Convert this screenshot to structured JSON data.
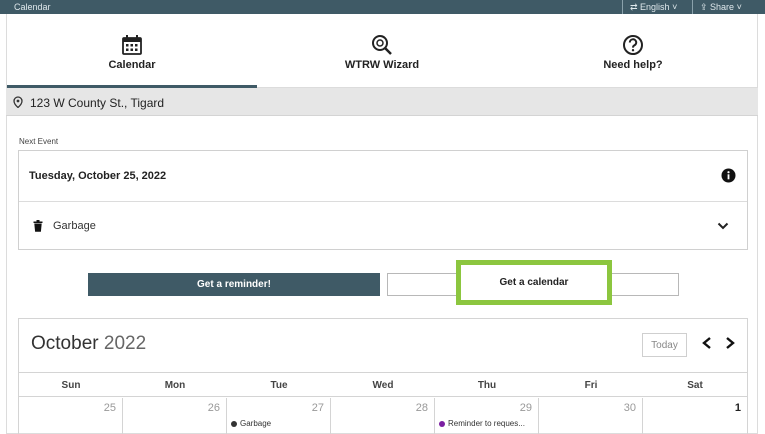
{
  "topbar": {
    "title": "Calendar",
    "language": "English",
    "share": "Share"
  },
  "nav": [
    {
      "label": "Calendar",
      "icon": "calendar-icon",
      "active": true
    },
    {
      "label": "WTRW Wizard",
      "icon": "wizard-search-icon",
      "active": false
    },
    {
      "label": "Need help?",
      "icon": "help-icon",
      "active": false
    }
  ],
  "address": {
    "text": "123 W County St., Tigard",
    "icon": "location-pin-icon"
  },
  "next_event": {
    "label": "Next Event",
    "date": "Tuesday, October 25, 2022",
    "type": "Garbage"
  },
  "buttons": {
    "reminder": "Get a reminder!",
    "calendar": "Get a calendar"
  },
  "calendar": {
    "month": "October",
    "year": "2022",
    "today_label": "Today",
    "weekdays": [
      "Sun",
      "Mon",
      "Tue",
      "Wed",
      "Thu",
      "Fri",
      "Sat"
    ],
    "days": [
      {
        "num": "25",
        "current": false,
        "event": ""
      },
      {
        "num": "26",
        "current": false,
        "event": ""
      },
      {
        "num": "27",
        "current": false,
        "event": "Garbage",
        "event_color": "#333333"
      },
      {
        "num": "28",
        "current": false,
        "event": ""
      },
      {
        "num": "29",
        "current": false,
        "event": "Reminder to reques...",
        "event_color": "#7b1fa2"
      },
      {
        "num": "30",
        "current": false,
        "event": ""
      },
      {
        "num": "1",
        "current": true,
        "event": ""
      }
    ]
  },
  "colors": {
    "header": "#3f5a66",
    "highlight": "#8cc63f"
  }
}
